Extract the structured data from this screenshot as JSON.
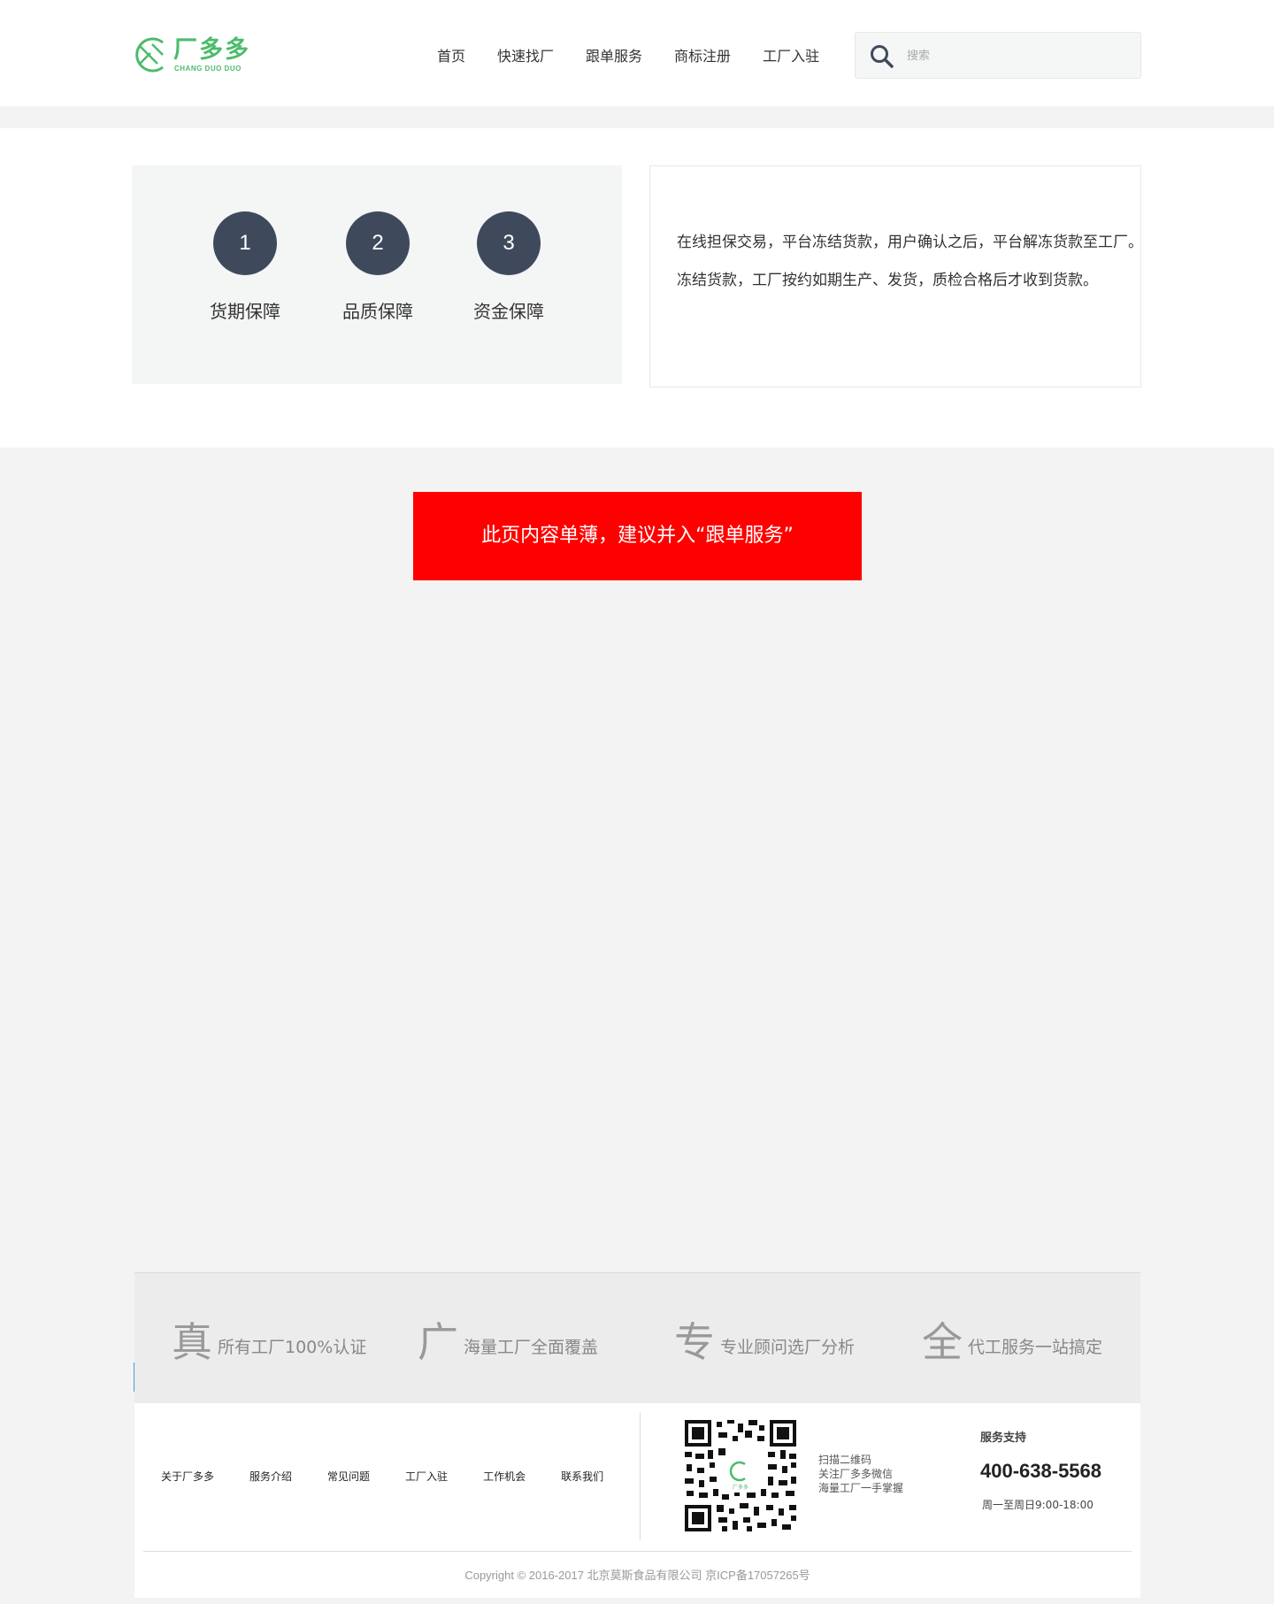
{
  "header": {
    "logo_cn": "厂多多",
    "logo_en": "CHANG DUO DUO",
    "nav": [
      "首页",
      "快速找厂",
      "跟单服务",
      "商标注册",
      "工厂入驻"
    ],
    "search_placeholder": "搜索"
  },
  "guarantee": {
    "steps": [
      {
        "number": "1",
        "label": "货期保障"
      },
      {
        "number": "2",
        "label": "品质保障"
      },
      {
        "number": "3",
        "label": "资金保障"
      }
    ],
    "desc_lines": [
      "在线担保交易，平台冻结货款，用户确认之后，平台解冻货款至工厂。",
      "冻结货款，工厂按约如期生产、发货，质检合格后才收到货款。"
    ]
  },
  "banner": {
    "text": "此页内容单薄，建议并入“跟单服务”"
  },
  "features": [
    {
      "char": "真",
      "text": "所有工厂100%认证"
    },
    {
      "char": "广",
      "text": "海量工厂全面覆盖"
    },
    {
      "char": "专",
      "text": "专业顾问选厂分析"
    },
    {
      "char": "全",
      "text": "代工服务一站搞定"
    }
  ],
  "footer": {
    "links": [
      "关于厂多多",
      "服务介绍",
      "常见问题",
      "工厂入驻",
      "工作机会",
      "联系我们"
    ],
    "qr_lines": [
      "扫描二维码",
      "关注厂多多微信",
      "海量工厂一手掌握"
    ],
    "qr_center_label": "厂多多",
    "support_title": "服务支持",
    "support_phone": "400-638-5568",
    "support_hours": "周一至周日9:00-18:00",
    "copyright": "Copyright © 2016-2017 北京莫斯食品有限公司 京ICP备17057265号"
  },
  "colors": {
    "brand_green": "#4cbb6c",
    "step_circle": "#3e4a5c",
    "banner_red": "#ff0000"
  }
}
